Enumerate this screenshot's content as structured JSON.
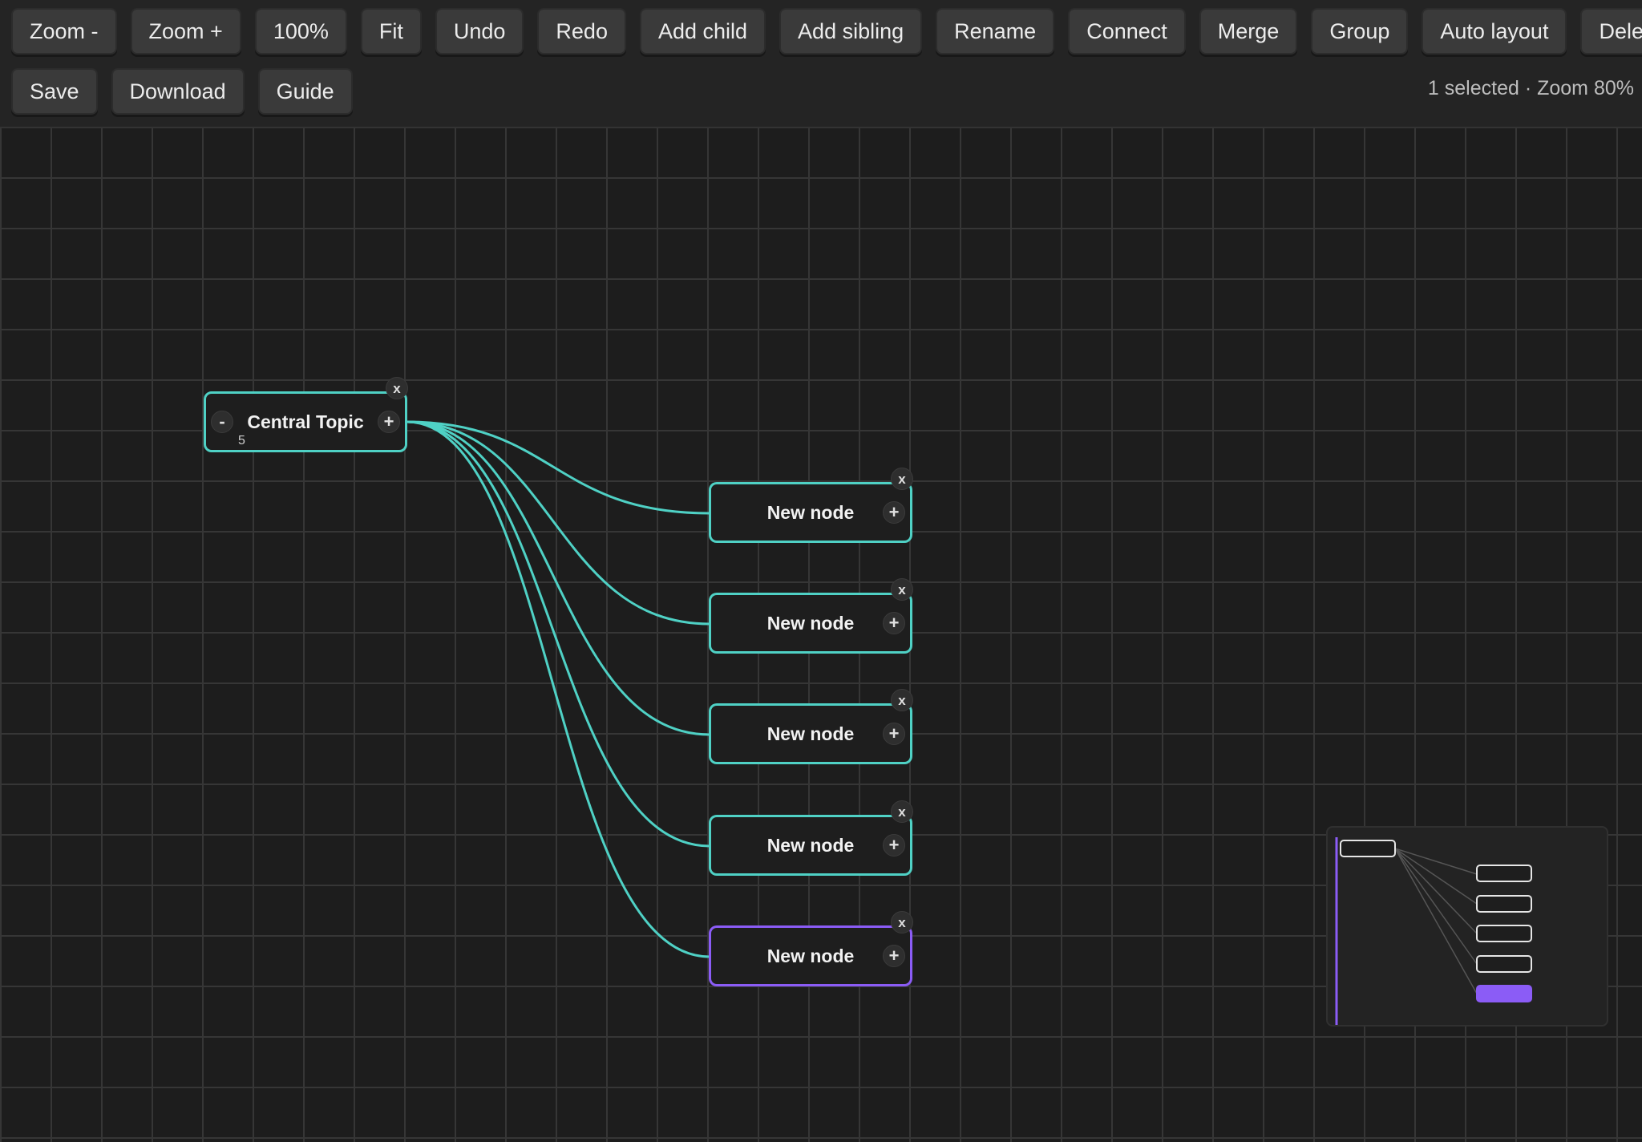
{
  "toolbar": {
    "row1": [
      {
        "id": "zoom-out",
        "label": "Zoom -"
      },
      {
        "id": "zoom-in",
        "label": "Zoom +"
      },
      {
        "id": "zoom-reset",
        "label": "100%"
      },
      {
        "id": "fit",
        "label": "Fit"
      },
      {
        "id": "undo",
        "label": "Undo"
      },
      {
        "id": "redo",
        "label": "Redo"
      },
      {
        "id": "add-child",
        "label": "Add child"
      },
      {
        "id": "add-sibling",
        "label": "Add sibling"
      },
      {
        "id": "rename",
        "label": "Rename"
      },
      {
        "id": "connect",
        "label": "Connect"
      },
      {
        "id": "merge",
        "label": "Merge"
      },
      {
        "id": "group",
        "label": "Group"
      },
      {
        "id": "auto-layout",
        "label": "Auto layout"
      },
      {
        "id": "delete",
        "label": "Delete"
      }
    ],
    "row2": [
      {
        "id": "save",
        "label": "Save"
      },
      {
        "id": "download",
        "label": "Download"
      },
      {
        "id": "guide",
        "label": "Guide"
      }
    ],
    "status": "1 selected · Zoom 80%"
  },
  "mindmap": {
    "root": {
      "label": "Central Topic",
      "child_count": "5",
      "collapse_glyph": "-",
      "add_glyph": "+",
      "close_glyph": "x"
    },
    "children": [
      {
        "label": "New node",
        "selected": false
      },
      {
        "label": "New node",
        "selected": false
      },
      {
        "label": "New node",
        "selected": false
      },
      {
        "label": "New node",
        "selected": false
      },
      {
        "label": "New node",
        "selected": true
      }
    ],
    "node_add_glyph": "+",
    "node_close_glyph": "x"
  },
  "colors": {
    "edge": "#4fd1c5",
    "node_border": "#4fd1c5",
    "selected_border": "#8b5cf6",
    "canvas_bg": "#1d1d1d",
    "grid_line": "#363636"
  }
}
